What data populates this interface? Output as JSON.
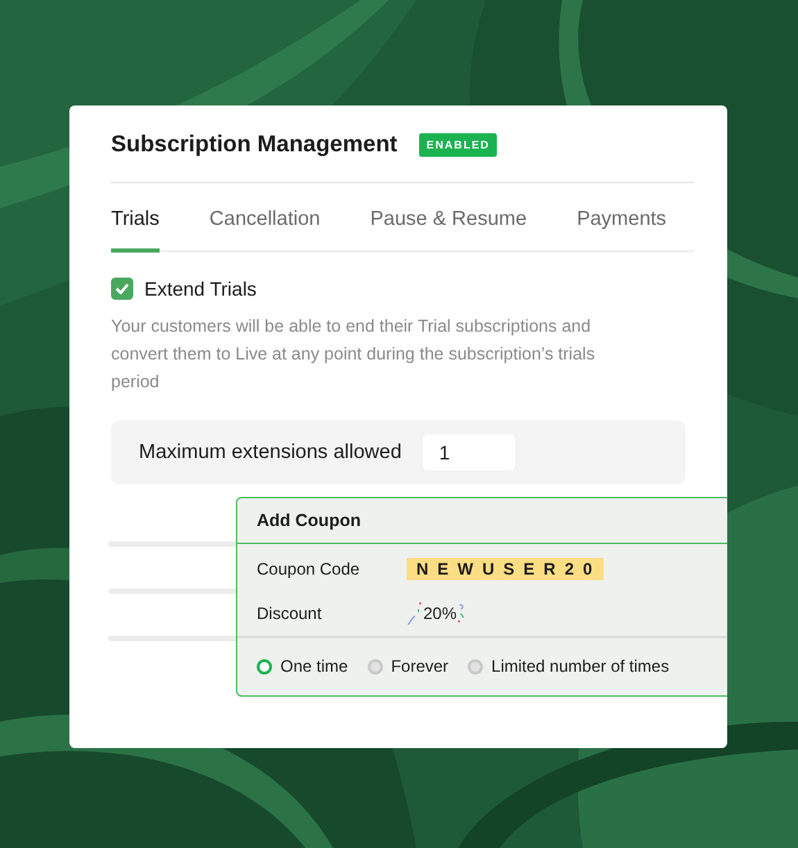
{
  "title": "Subscription Management",
  "status_badge": "ENABLED",
  "tabs": [
    {
      "label": "Trials",
      "selected": true
    },
    {
      "label": "Cancellation",
      "selected": false
    },
    {
      "label": "Pause & Resume",
      "selected": false
    },
    {
      "label": "Payments",
      "selected": false
    }
  ],
  "extend_trials": {
    "label": "Extend Trials",
    "checked": true
  },
  "description": "Your customers will be able to end their Trial  subscriptions and convert them to Live at any point during the subscription’s trials period",
  "max_extensions": {
    "label": "Maximum extensions allowed",
    "value": "1"
  },
  "coupon": {
    "title": "Add Coupon",
    "fields": [
      {
        "label": "Coupon Code",
        "value": "NEWUSER20",
        "kind": "code"
      },
      {
        "label": "Discount",
        "value": "20%",
        "kind": "confetti"
      }
    ],
    "durations": [
      {
        "label": "One time",
        "selected": true
      },
      {
        "label": "Forever",
        "selected": false
      },
      {
        "label": "Limited number of times",
        "selected": false
      }
    ]
  }
}
